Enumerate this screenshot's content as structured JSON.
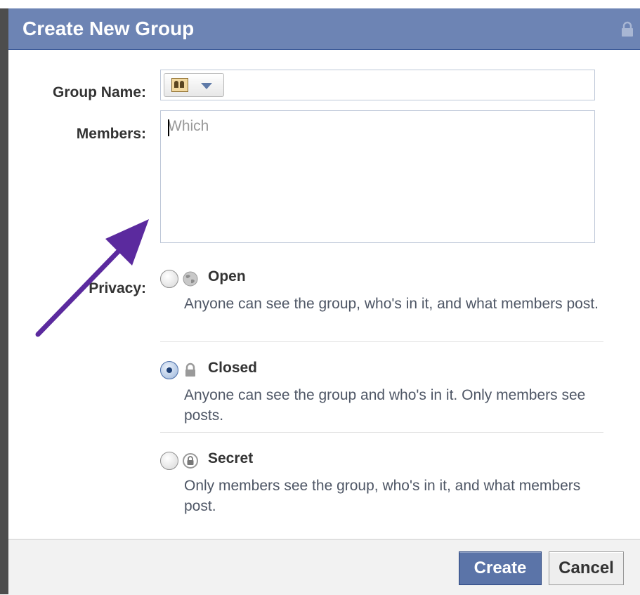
{
  "dialog": {
    "title": "Create New Group",
    "title_icon": "lock-icon"
  },
  "form": {
    "group_name": {
      "label": "Group Name:",
      "value": "",
      "icon": "group-icon"
    },
    "members": {
      "label": "Members:",
      "placeholder": "Which",
      "value": ""
    },
    "privacy": {
      "label": "Privacy:",
      "selected": "Closed",
      "options": [
        {
          "title": "Open",
          "icon": "globe-icon",
          "description": "Anyone can see the group, who's in it, and what members post.",
          "checked": false
        },
        {
          "title": "Closed",
          "icon": "lock-icon",
          "description": "Anyone can see the group and who's in it. Only members see posts.",
          "checked": true
        },
        {
          "title": "Secret",
          "icon": "secret-lock-icon",
          "description": "Only members see the group, who's in it, and what members post.",
          "checked": false
        }
      ]
    }
  },
  "footer": {
    "create_label": "Create",
    "cancel_label": "Cancel"
  },
  "colors": {
    "header_bg": "#6d84b4",
    "primary_button": "#5b74a8",
    "annotation_arrow": "#5b2a9e"
  }
}
